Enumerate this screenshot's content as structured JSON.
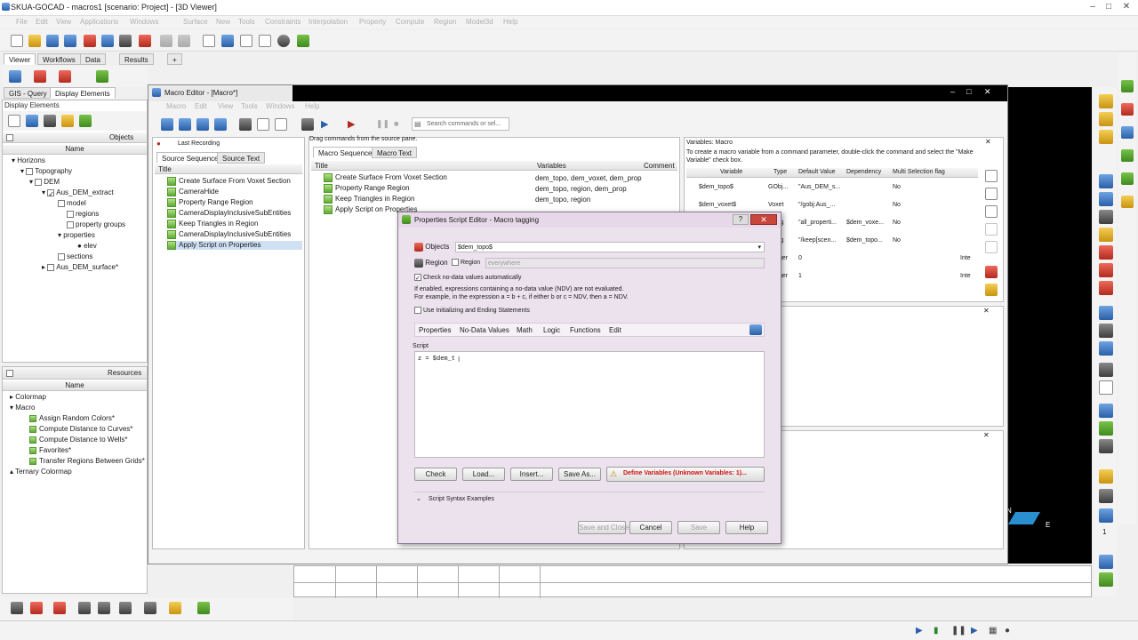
{
  "window": {
    "title": "SKUA-GOCAD - macros1 [scenario: Project] - [3D Viewer]"
  },
  "menu": [
    "File",
    "Edit",
    "View",
    "Applications",
    "Windows",
    "Surface",
    "New",
    "Tools",
    "Constraints",
    "Interpolation",
    "Property",
    "Compute",
    "Region",
    "Model3d",
    "Help"
  ],
  "viewer_tabs": {
    "viewer": "Viewer",
    "workflows": "Workflows",
    "data": "Data",
    "results": "Results",
    "add": "+"
  },
  "left_tabs": {
    "gis": "GIS - Query",
    "display": "Display Elements"
  },
  "display_elements": {
    "title": "Display Elements",
    "objects_label": "Objects",
    "name_header": "Name",
    "tree": [
      "Horizons",
      "Topography",
      "DEM",
      "Aus_DEM_extract",
      "model",
      "regions",
      "property groups",
      "properties",
      "elev",
      "sections",
      "Aus_DEM_surface*"
    ]
  },
  "resources": {
    "title": "Resources",
    "name_header": "Name",
    "tree": [
      "Colormap",
      "Macro",
      "Assign Random Colors*",
      "Compute Distance to Curves*",
      "Compute Distance to Wells*",
      "Favorites*",
      "Transfer Regions Between Grids*",
      "Ternary Colormap"
    ]
  },
  "macro_editor": {
    "title": "Macro Editor - [Macro*]",
    "menu": [
      "Macro",
      "Edit",
      "View",
      "Tools",
      "Windows",
      "Help"
    ],
    "search_placeholder": "Search commands or sel...",
    "last_recording": "Last Recording",
    "source_tabs": [
      "Source Sequence",
      "Source Text"
    ],
    "source_title_header": "Title",
    "source_items": [
      "Create Surface From Voxet Section",
      "CameraHide",
      "Property Range Region",
      "CameraDisplayInclusiveSubEntities",
      "Keep Triangles in Region",
      "CameraDisplayInclusiveSubEntities",
      "Apply Script on Properties"
    ],
    "drag_hint": "Drag commands from the source pane.",
    "macro_tabs": [
      "Macro Sequence",
      "Macro Text"
    ],
    "seq_headers": {
      "title": "Title",
      "variables": "Variables",
      "comment": "Comment"
    },
    "seq_rows": [
      {
        "title": "Create Surface From Voxet Section",
        "vars": "dem_topo, dem_voxet, dem_prop"
      },
      {
        "title": "Property Range Region",
        "vars": "dem_topo, region, dem_prop"
      },
      {
        "title": "Keep Triangles in Region",
        "vars": "dem_topo, region"
      },
      {
        "title": "Apply Script on Properties",
        "vars": ""
      }
    ],
    "variables": {
      "title": "Variables: Macro",
      "hint": "To create a macro variable from a command parameter, double-click the command and select the \"Make Variable\" check box.",
      "headers": [
        "Variable",
        "Type",
        "Default Value",
        "Dependency",
        "Multi Selection flag"
      ],
      "rows": [
        [
          "$dem_topo$",
          "GObj...",
          "\"Aus_DEM_s...",
          "",
          "No"
        ],
        [
          "$dem_voxet$",
          "Voxet",
          "\"/gobj:Aus_...",
          "",
          "No"
        ],
        [
          "",
          "ig",
          "\"all_properti...",
          "$dem_voxe...",
          "No"
        ],
        [
          "",
          "ig",
          "\"/keep[scen...",
          "$dem_topo...",
          "No"
        ],
        [
          "",
          "ger",
          "0",
          "",
          "",
          "Inte"
        ],
        [
          "",
          "ger",
          "1",
          "",
          "",
          "Inte"
        ]
      ]
    }
  },
  "dialog": {
    "title": "Properties Script Editor - Macro tagging",
    "objects_label": "Objects",
    "objects_value": "$dem_topo$",
    "region_label": "Region",
    "region_check_label": "Region",
    "region_value": "everywhere",
    "check_ndv": "Check no-data values automatically",
    "ndv_info1": "If enabled, expressions containing a no-data value (NDV) are not evaluated.",
    "ndv_info2": "For example, in the expression a = b + c, if either b or c = NDV, then a = NDV.",
    "init_statements": "Use Initializing and Ending Statements",
    "menu": [
      "Properties",
      "No-Data Values",
      "Math",
      "Logic",
      "Functions",
      "Edit"
    ],
    "script_label": "Script",
    "script_text": "z = $dem_t",
    "buttons": {
      "check": "Check",
      "load": "Load...",
      "insert": "Insert...",
      "save_as": "Save As...",
      "define": "Define Variables (Unknown Variables: 1)...",
      "examples": "Script Syntax Examples",
      "save_close": "Save and Close",
      "cancel": "Cancel",
      "save": "Save",
      "help": "Help"
    }
  },
  "compass": {
    "n": "N",
    "e": "E"
  },
  "side_counter": "1",
  "colors": {
    "accent": "#3a6ea5",
    "dialog_bg": "#ece2ee",
    "warn": "#cc1111",
    "viewer": "#000000"
  }
}
